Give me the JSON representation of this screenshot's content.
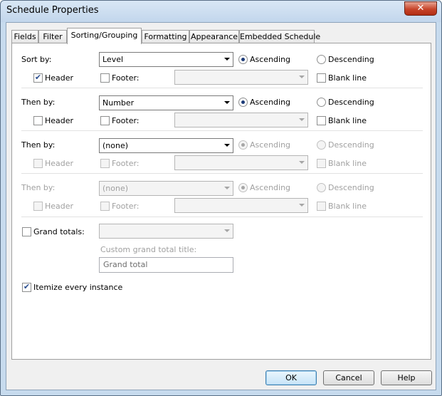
{
  "window": {
    "title": "Schedule Properties",
    "close_label": "✕"
  },
  "tabs": [
    "Fields",
    "Filter",
    "Sorting/Grouping",
    "Formatting",
    "Appearance",
    "Embedded Schedule"
  ],
  "rows": [
    {
      "label": "Sort by:",
      "value": "Level",
      "ascending": "Ascending",
      "descending": "Descending",
      "header": "Header",
      "footer": "Footer:",
      "blank_line": "Blank line"
    },
    {
      "label": "Then by:",
      "value": "Number",
      "ascending": "Ascending",
      "descending": "Descending",
      "header": "Header",
      "footer": "Footer:",
      "blank_line": "Blank line"
    },
    {
      "label": "Then by:",
      "value": "(none)",
      "ascending": "Ascending",
      "descending": "Descending",
      "header": "Header",
      "footer": "Footer:",
      "blank_line": "Blank line"
    },
    {
      "label": "Then by:",
      "value": "(none)",
      "ascending": "Ascending",
      "descending": "Descending",
      "header": "Header",
      "footer": "Footer:",
      "blank_line": "Blank line"
    }
  ],
  "grand_totals": {
    "label": "Grand totals:",
    "custom_title_label": "Custom grand total title:",
    "custom_title_value": "Grand total"
  },
  "itemize": {
    "label": "Itemize every instance"
  },
  "buttons": {
    "ok": "OK",
    "cancel": "Cancel",
    "help": "Help"
  },
  "colors": {
    "title_bar": "#c7dbee",
    "close": "#c7452a",
    "dialog_bg": "#f0f0f0"
  }
}
